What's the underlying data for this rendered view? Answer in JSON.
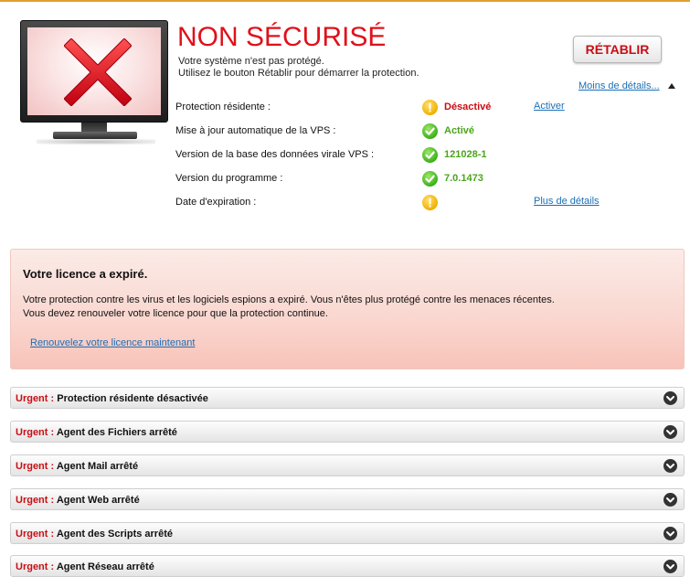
{
  "status": {
    "title": "NON SÉCURISÉ",
    "line1": "Votre système n'est pas protégé.",
    "line2": "Utilisez le bouton Rétablir pour démarrer la protection.",
    "restore_label": "RÉTABLIR",
    "less_details_label": "Moins de détails..."
  },
  "info_rows": [
    {
      "label": "Protection résidente :",
      "icon": "warning-icon",
      "value": "Désactivé",
      "value_state": "bad",
      "link": "Activer"
    },
    {
      "label": "Mise à jour automatique de la VPS :",
      "icon": "check-icon",
      "value": "Activé",
      "value_state": "good",
      "link": ""
    },
    {
      "label": "Version de la base des données virale VPS :",
      "icon": "check-icon",
      "value": "121028-1",
      "value_state": "good",
      "link": ""
    },
    {
      "label": "Version du programme :",
      "icon": "check-icon",
      "value": "7.0.1473",
      "value_state": "good",
      "link": ""
    },
    {
      "label": "Date d'expiration :",
      "icon": "warning-icon",
      "value": "",
      "value_state": "bad",
      "link": "Plus de détails"
    }
  ],
  "license": {
    "title": "Votre licence a expiré.",
    "text1": "Votre protection contre les virus et les logiciels espions a expiré. Vous n'êtes plus protégé contre les menaces récentes.",
    "text2": "Vous devez renouveler votre licence pour que la protection continue.",
    "renew_link": "Renouvelez votre licence maintenant"
  },
  "alerts": {
    "urgent_label": "Urgent :",
    "items": [
      "Protection résidente désactivée",
      "Agent des Fichiers arrêté",
      "Agent Mail arrêté",
      "Agent Web arrêté",
      "Agent des Scripts arrêté",
      "Agent Réseau arrêté"
    ]
  },
  "colors": {
    "alert_red": "#e0101a",
    "link_blue": "#1b6fb8",
    "ok_green": "#4ca41c",
    "warning_yellow": "#f0b000"
  }
}
